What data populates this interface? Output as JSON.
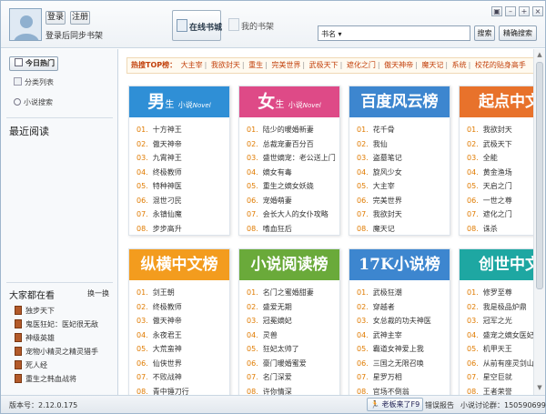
{
  "header": {
    "login_label": "登录",
    "register_label": "注册",
    "sync_text": "登录后同步书架",
    "online_tab_label": "在线书城",
    "shelf_tab_label": "我的书架",
    "search_type": "书名",
    "search_placeholder": "",
    "search_button": "搜索",
    "precise_search_button": "精确搜索"
  },
  "sidebar": {
    "today_hot": "今日热门",
    "category_list": "分类列表",
    "novel_search": "小说搜索",
    "recent_title": "最近阅读",
    "watching_title": "大家都在看",
    "refresh_label": "换一换",
    "watching_items": [
      "独步天下",
      "鬼医狂妃：医妃很无敌",
      "神级英雄",
      "宠物小精灵之精灵猎手",
      "死人经",
      "重生之韩血战将"
    ]
  },
  "hot_top": {
    "label": "热搜TOP榜：",
    "items": [
      "大主宰",
      "我欲封天",
      "重生",
      "完美世界",
      "武极天下",
      "遮化之门",
      "傲天神帝",
      "魔天记",
      "系统",
      "校花的贴身高手"
    ]
  },
  "cards": [
    {
      "title_main": "男",
      "title_sub": "生",
      "title_tag": "小说",
      "title_en": "Novel",
      "color": "#2f8fd6",
      "items": [
        "十方神王",
        "傲天神帝",
        "九霄神王",
        "终极教师",
        "特种神医",
        "混世刁民",
        "永镇仙魔",
        "步步高升"
      ]
    },
    {
      "title_main": "女",
      "title_sub": "生",
      "title_tag": "小说",
      "title_en": "Novel",
      "color": "#de4a87",
      "items": [
        "陆少的暖婚新妻",
        "总裁宠妻百分百",
        "盛世嫡宠：老公送上门",
        "嫡女有毒",
        "重生之嫡女妖娆",
        "宠婚萌妻",
        "会长大人的女仆攻略",
        "嗜血狂后"
      ]
    },
    {
      "title": "百度风云榜",
      "color": "#3d86cf",
      "items": [
        "花千骨",
        "我仙",
        "盗墓笔记",
        "旋风少女",
        "大主宰",
        "完美世界",
        "我欲封天",
        "魔天记"
      ]
    },
    {
      "title": "起点中文",
      "color": "#e8722b",
      "items": [
        "我欲封天",
        "武极天下",
        "全能",
        "黄金渔场",
        "天启之门",
        "一世之尊",
        "遮化之门",
        "诛杀"
      ]
    },
    {
      "title": "纵横中文榜",
      "color": "#f39c1e",
      "items": [
        "剑王朝",
        "终极教师",
        "傲天神帝",
        "永夜君王",
        "大荒蛮神",
        "仙侠世界",
        "不败战神",
        "青中锤刀行"
      ]
    },
    {
      "title": "小说阅读榜",
      "color": "#6aaa3a",
      "items": [
        "名门之蜜婚甜妻",
        "盛爱无期",
        "冠冕嫡妃",
        "灵兽",
        "狂妃太帅了",
        "豪门暖婚蜜爱",
        "名门深爱",
        "许你情深"
      ]
    },
    {
      "title": "17K小说榜",
      "color": "#3d86cf",
      "items": [
        "武极狂潮",
        "穿越者",
        "女总裁的功夫神医",
        "武神主宰",
        "霸道女神爱上我",
        "三国之无限召唤",
        "星罗万相",
        "官场不倒翁"
      ]
    },
    {
      "title": "创世中文",
      "color": "#1ea7a2",
      "items": [
        "修罗至尊",
        "我是极品炉鼎",
        "冠军之光",
        "盛宠之嫡女医妃",
        "机甲天王",
        "从前有座灵剑山",
        "星空巨就",
        "王者荣誉"
      ]
    }
  ],
  "status": {
    "version": "版本号：2.12.0.175",
    "boss_label": "老板来了F9",
    "error_report": "错误报告",
    "qq_group": "小说讨论群：150590699"
  }
}
